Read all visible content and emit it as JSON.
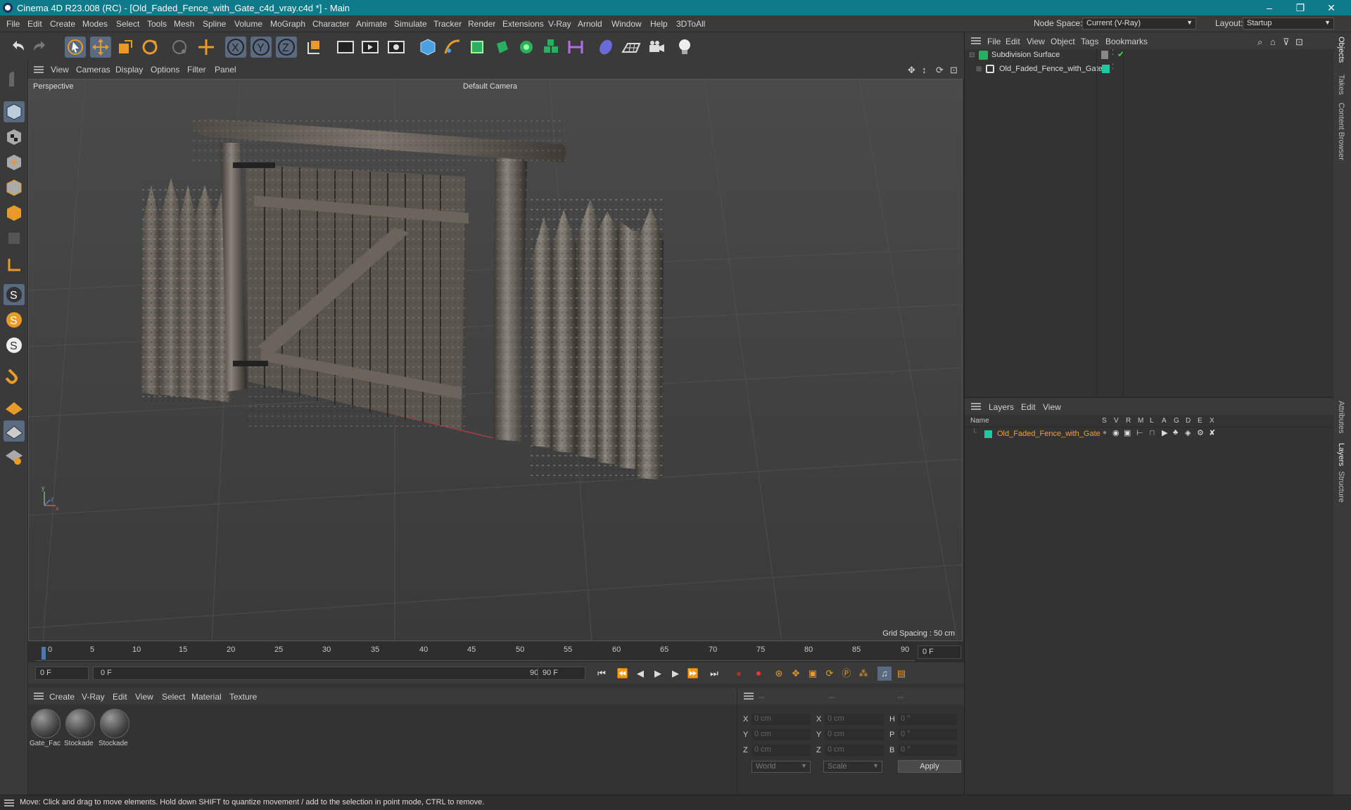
{
  "window": {
    "title": "Cinema 4D R23.008 (RC) - [Old_Faded_Fence_with_Gate_c4d_vray.c4d *] - Main",
    "minimize": "–",
    "restore": "❐",
    "close": "✕"
  },
  "menubar": {
    "items": [
      "File",
      "Edit",
      "Create",
      "Modes",
      "Select",
      "Tools",
      "Mesh",
      "Spline",
      "Volume",
      "MoGraph",
      "Character",
      "Animate",
      "Simulate",
      "Tracker",
      "Render",
      "Extensions",
      "V-Ray",
      "Arnold",
      "Window",
      "Help",
      "3DToAll"
    ],
    "node_space_label": "Node Space:",
    "node_space_value": "Current (V-Ray)",
    "layout_label": "Layout:",
    "layout_value": "Startup"
  },
  "viewport": {
    "menu": [
      "View",
      "Cameras",
      "Display",
      "Options",
      "Filter",
      "Panel"
    ],
    "label": "Perspective",
    "camera": "Default Camera",
    "grid_spacing": "Grid Spacing : 50 cm"
  },
  "timeline": {
    "ticks": [
      "0",
      "5",
      "10",
      "15",
      "20",
      "25",
      "30",
      "35",
      "40",
      "45",
      "50",
      "55",
      "60",
      "65",
      "70",
      "75",
      "80",
      "85",
      "90"
    ],
    "current_frame": "0 F",
    "start": "0 F",
    "range_start": "0 F",
    "range_end": "90 F",
    "end": "90 F"
  },
  "materials": {
    "menu": [
      "Create",
      "V-Ray",
      "Edit",
      "View",
      "Select",
      "Material",
      "Texture"
    ],
    "items": [
      "Gate_Fac",
      "Stockade",
      "Stockade"
    ]
  },
  "coordinates": {
    "headers": [
      "--",
      "--",
      "--"
    ],
    "rows": [
      {
        "a": "X",
        "av": "0 cm",
        "b": "X",
        "bv": "0 cm",
        "c": "H",
        "cv": "0 °"
      },
      {
        "a": "Y",
        "av": "0 cm",
        "b": "Y",
        "bv": "0 cm",
        "c": "P",
        "cv": "0 °"
      },
      {
        "a": "Z",
        "av": "0 cm",
        "b": "Z",
        "bv": "0 cm",
        "c": "B",
        "cv": "0 °"
      }
    ],
    "space": "World",
    "mode": "Scale",
    "apply": "Apply"
  },
  "objects": {
    "menu": [
      "File",
      "Edit",
      "View",
      "Object",
      "Tags",
      "Bookmarks"
    ],
    "tree": [
      "Subdivision Surface",
      "Old_Faded_Fence_with_Gate"
    ]
  },
  "layers": {
    "menu": [
      "Layers",
      "Edit",
      "View"
    ],
    "columns": [
      "Name",
      "S",
      "V",
      "R",
      "M",
      "L",
      "A",
      "G",
      "D",
      "E",
      "X"
    ],
    "rows": [
      "Old_Faded_Fence_with_Gate"
    ]
  },
  "side_tabs": [
    "Objects",
    "Takes",
    "Content Browser",
    "Attributes",
    "Layers",
    "Structure"
  ],
  "status": "Move: Click and drag to move elements. Hold down SHIFT to quantize movement / add to the selection in point mode, CTRL to remove.",
  "colors": {
    "titlebar": "#0f7b8a",
    "accent": "#f0a030",
    "layer_green": "#1ec8a0"
  }
}
